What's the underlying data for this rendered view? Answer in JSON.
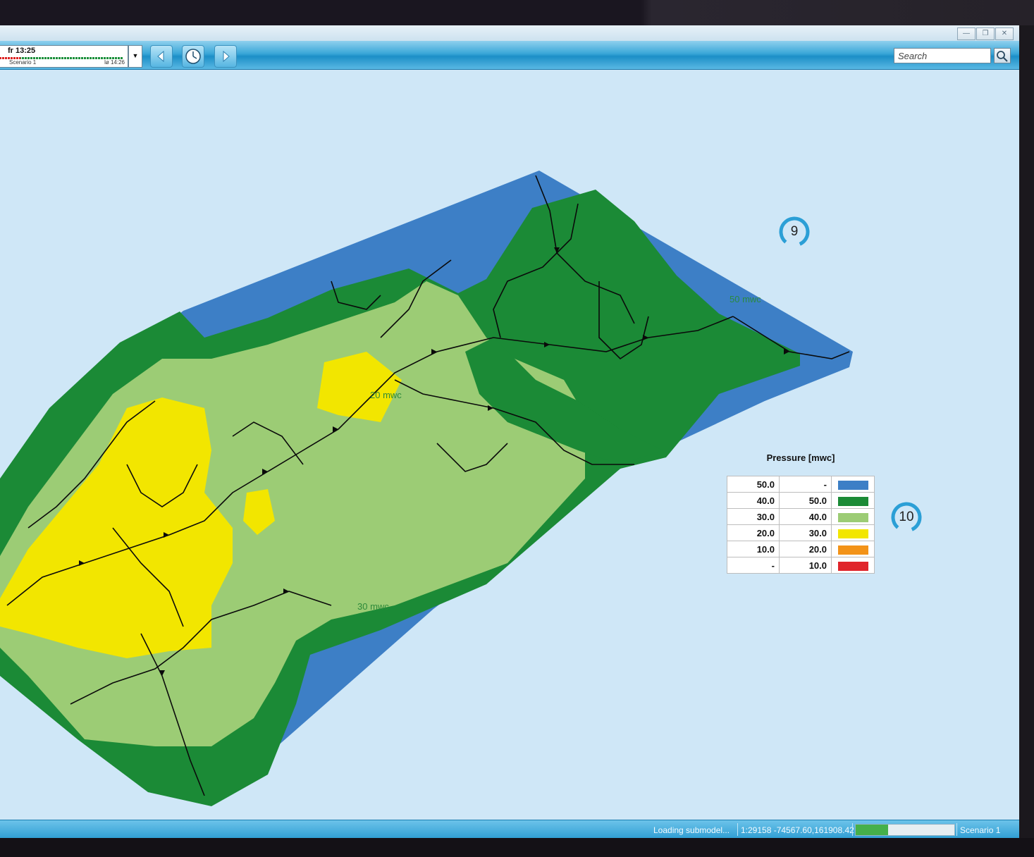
{
  "toolbar": {
    "time_current": "fr 13:25",
    "scenario_label": "Scenario 1",
    "time_end": "lø 14:26",
    "search_placeholder": "Search"
  },
  "map": {
    "contour_labels": [
      "20 mwc",
      "30 mwc",
      "50 mwc"
    ]
  },
  "badges": [
    "9",
    "10"
  ],
  "legend": {
    "title": "Pressure [mwc]",
    "rows": [
      {
        "from": "50.0",
        "to": "-",
        "color": "#3d7fc6"
      },
      {
        "from": "40.0",
        "to": "50.0",
        "color": "#1b8a36"
      },
      {
        "from": "30.0",
        "to": "40.0",
        "color": "#9ccc75"
      },
      {
        "from": "20.0",
        "to": "30.0",
        "color": "#f2e600"
      },
      {
        "from": "10.0",
        "to": "20.0",
        "color": "#f39318"
      },
      {
        "from": "-",
        "to": "10.0",
        "color": "#e0242a"
      }
    ]
  },
  "statusbar": {
    "message": "Loading submodel...",
    "coords": "1:29158 -74567.60,161908.42",
    "progress": 0.33,
    "scenario": "Scenario 1"
  },
  "colors": {
    "accent": "#2b9fd6",
    "map_background": "#cfe7f7"
  }
}
